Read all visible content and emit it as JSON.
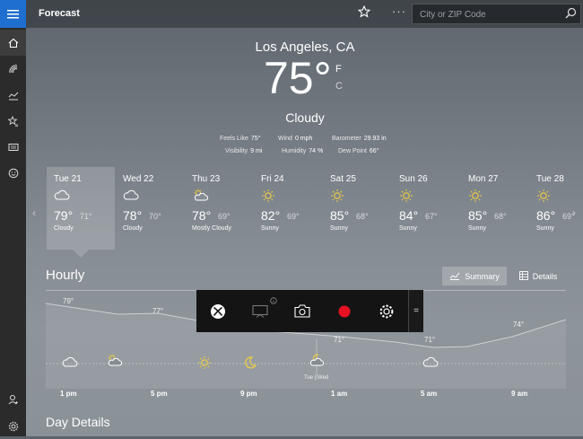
{
  "app": {
    "title": "Forecast"
  },
  "search": {
    "placeholder": "City or ZIP Code"
  },
  "current": {
    "location": "Los Angeles, CA",
    "temperature": "75",
    "degree": "°",
    "unit_f": "F",
    "unit_c": "C",
    "condition": "Cloudy",
    "stats": {
      "feels_like": {
        "label": "Feels Like",
        "value": "75°"
      },
      "wind": {
        "label": "Wind",
        "value": "0 mph"
      },
      "barometer": {
        "label": "Barometer",
        "value": "29.93 in"
      },
      "visibility": {
        "label": "Visibility",
        "value": "9 mi"
      },
      "humidity": {
        "label": "Humidity",
        "value": "74 %"
      },
      "dew_point": {
        "label": "Dew Point",
        "value": "66°"
      }
    }
  },
  "forecast": [
    {
      "day": "Tue 21",
      "high": "79°",
      "low": "71°",
      "condition": "Cloudy",
      "icon": "cloud-icon"
    },
    {
      "day": "Wed 22",
      "high": "78°",
      "low": "70°",
      "condition": "Cloudy",
      "icon": "cloud-icon"
    },
    {
      "day": "Thu 23",
      "high": "78°",
      "low": "69°",
      "condition": "Mostly Cloudy",
      "icon": "partly-cloudy-icon"
    },
    {
      "day": "Fri 24",
      "high": "82°",
      "low": "69°",
      "condition": "Sunny",
      "icon": "sun-icon"
    },
    {
      "day": "Sat 25",
      "high": "85°",
      "low": "68°",
      "condition": "Sunny",
      "icon": "sun-icon"
    },
    {
      "day": "Sun 26",
      "high": "84°",
      "low": "67°",
      "condition": "Sunny",
      "icon": "sun-icon"
    },
    {
      "day": "Mon 27",
      "high": "85°",
      "low": "68°",
      "condition": "Sunny",
      "icon": "sun-icon"
    },
    {
      "day": "Tue 28",
      "high": "86°",
      "low": "69°",
      "condition": "Sunny",
      "icon": "sun-icon"
    }
  ],
  "hourly": {
    "title": "Hourly",
    "summary_label": "Summary",
    "details_label": "Details",
    "temp_labels": [
      "79°",
      "77°",
      "71°",
      "71°",
      "74°"
    ],
    "time_labels": [
      "1 pm",
      "5 pm",
      "9 pm",
      "1 am",
      "5 am",
      "9 am"
    ],
    "day_change_label": "Tue | Wed"
  },
  "day_details": {
    "title": "Day Details"
  },
  "colors": {
    "accent": "#1f6fd0",
    "record": "#e81123",
    "sun": "#f4d03f"
  }
}
